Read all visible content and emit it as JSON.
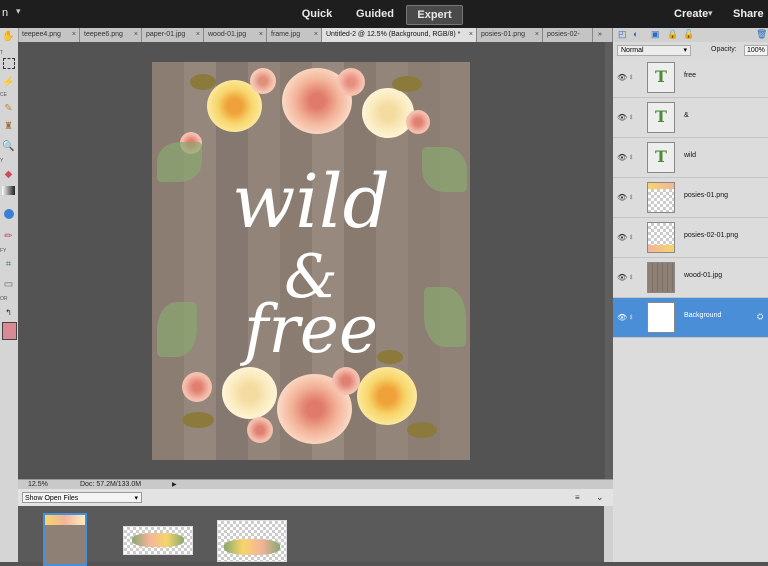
{
  "topbar": {
    "partial_left": "n",
    "modes": [
      {
        "label": "Quick",
        "active": false
      },
      {
        "label": "Guided",
        "active": false
      },
      {
        "label": "Expert",
        "active": true
      }
    ],
    "create_label": "Create",
    "share_label": "Share"
  },
  "tabs": [
    {
      "label": "teepee4.png"
    },
    {
      "label": "teepee6.png"
    },
    {
      "label": "paper-01.jpg"
    },
    {
      "label": "wood-01.jpg"
    },
    {
      "label": "frame.jpg"
    },
    {
      "label": "Untitled-2 @ 12.5% (Background, RGB/8) *",
      "active": true
    },
    {
      "label": "posies-01.png"
    },
    {
      "label": "posies-02-"
    }
  ],
  "tabs_overflow": "»",
  "toolbox": {
    "sections": [
      "T",
      "CE",
      "Y",
      "FY",
      "OR"
    ]
  },
  "document": {
    "line1": "wild",
    "line2": "&",
    "line3": "free"
  },
  "status": {
    "zoom": "12.5%",
    "doc": "Doc: 57.2M/133.0M"
  },
  "bin": {
    "dropdown": "Show Open Files"
  },
  "panel": {
    "blend_mode": "Normal",
    "opacity_label": "Opacity:",
    "opacity_value": "100%"
  },
  "layers": [
    {
      "name": "free",
      "type": "text"
    },
    {
      "name": "&",
      "type": "text"
    },
    {
      "name": "wild",
      "type": "text"
    },
    {
      "name": "posies-01.png",
      "type": "posies"
    },
    {
      "name": "posies-02-01.png",
      "type": "posies"
    },
    {
      "name": "wood-01.jpg",
      "type": "wood"
    },
    {
      "name": "Background",
      "type": "white",
      "selected": true
    }
  ],
  "colors": {
    "accent": "#4a8ed8",
    "wood": "#8e8074",
    "fg_swatch": "#d98a95"
  }
}
